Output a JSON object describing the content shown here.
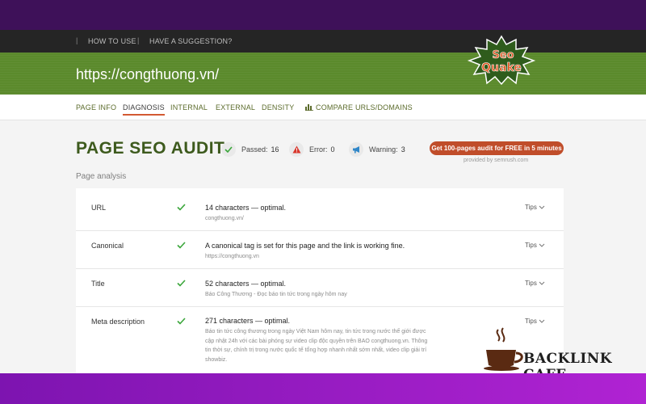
{
  "colors": {
    "top_band": "#3e1159",
    "nav_bg": "#252525",
    "green_bar": "#5b8a2c",
    "title_green": "#3d5a1d",
    "accent_orange": "#c04d2a",
    "check_green": "#3aa63a",
    "bottom_band": "#9b1cc4"
  },
  "topnav": {
    "sep": "|",
    "how_to_use": "HOW TO USE",
    "suggestion": "HAVE A SUGGESTION?"
  },
  "header": {
    "url": "https://congthuong.vn/",
    "logo_text_top": "Seo",
    "logo_text_bottom": "Quake"
  },
  "tabs": [
    {
      "label": "PAGE INFO"
    },
    {
      "label": "DIAGNOSIS"
    },
    {
      "label": "INTERNAL"
    },
    {
      "label": "EXTERNAL"
    },
    {
      "label": "DENSITY"
    },
    {
      "label": "COMPARE URLS/DOMAINS"
    }
  ],
  "audit": {
    "title": "PAGE SEO AUDIT",
    "passed_label": "Passed:",
    "passed_count": "16",
    "error_label": "Error:",
    "error_count": "0",
    "warning_label": "Warning:",
    "warning_count": "3",
    "cta": "Get 100-pages audit for FREE in 5 minutes",
    "provided_by": "provided by  semrush.com"
  },
  "section_label": "Page analysis",
  "rows": [
    {
      "label": "URL",
      "message": "14 characters — optimal.",
      "sub": "congthuong.vn/",
      "tips": "Tips"
    },
    {
      "label": "Canonical",
      "message": "A canonical tag is set for this page and the link is working fine.",
      "sub": "https://congthuong.vn",
      "tips": "Tips"
    },
    {
      "label": "Title",
      "message": "52 characters — optimal.",
      "sub": "Báo Công Thương - Đọc báo tin tức trong ngày hôm nay",
      "tips": "Tips"
    },
    {
      "label": "Meta description",
      "message": "271 characters — optimal.",
      "sub": "Báo tin tức công thương trong ngày Việt Nam hôm nay, tin tức trong nước thế giới được cập nhật 24h với các bài phóng sự video clip độc quyền trên BAO congthuong.vn. Thông tin thời sự, chính trị trong nước quốc tế tổng hợp nhanh nhất sớm nhất, video clip giải trí showbiz.",
      "tips": "Tips"
    }
  ],
  "watermark": {
    "text": "BACKLINK CAFE",
    "icon": "coffee-cup-icon"
  }
}
